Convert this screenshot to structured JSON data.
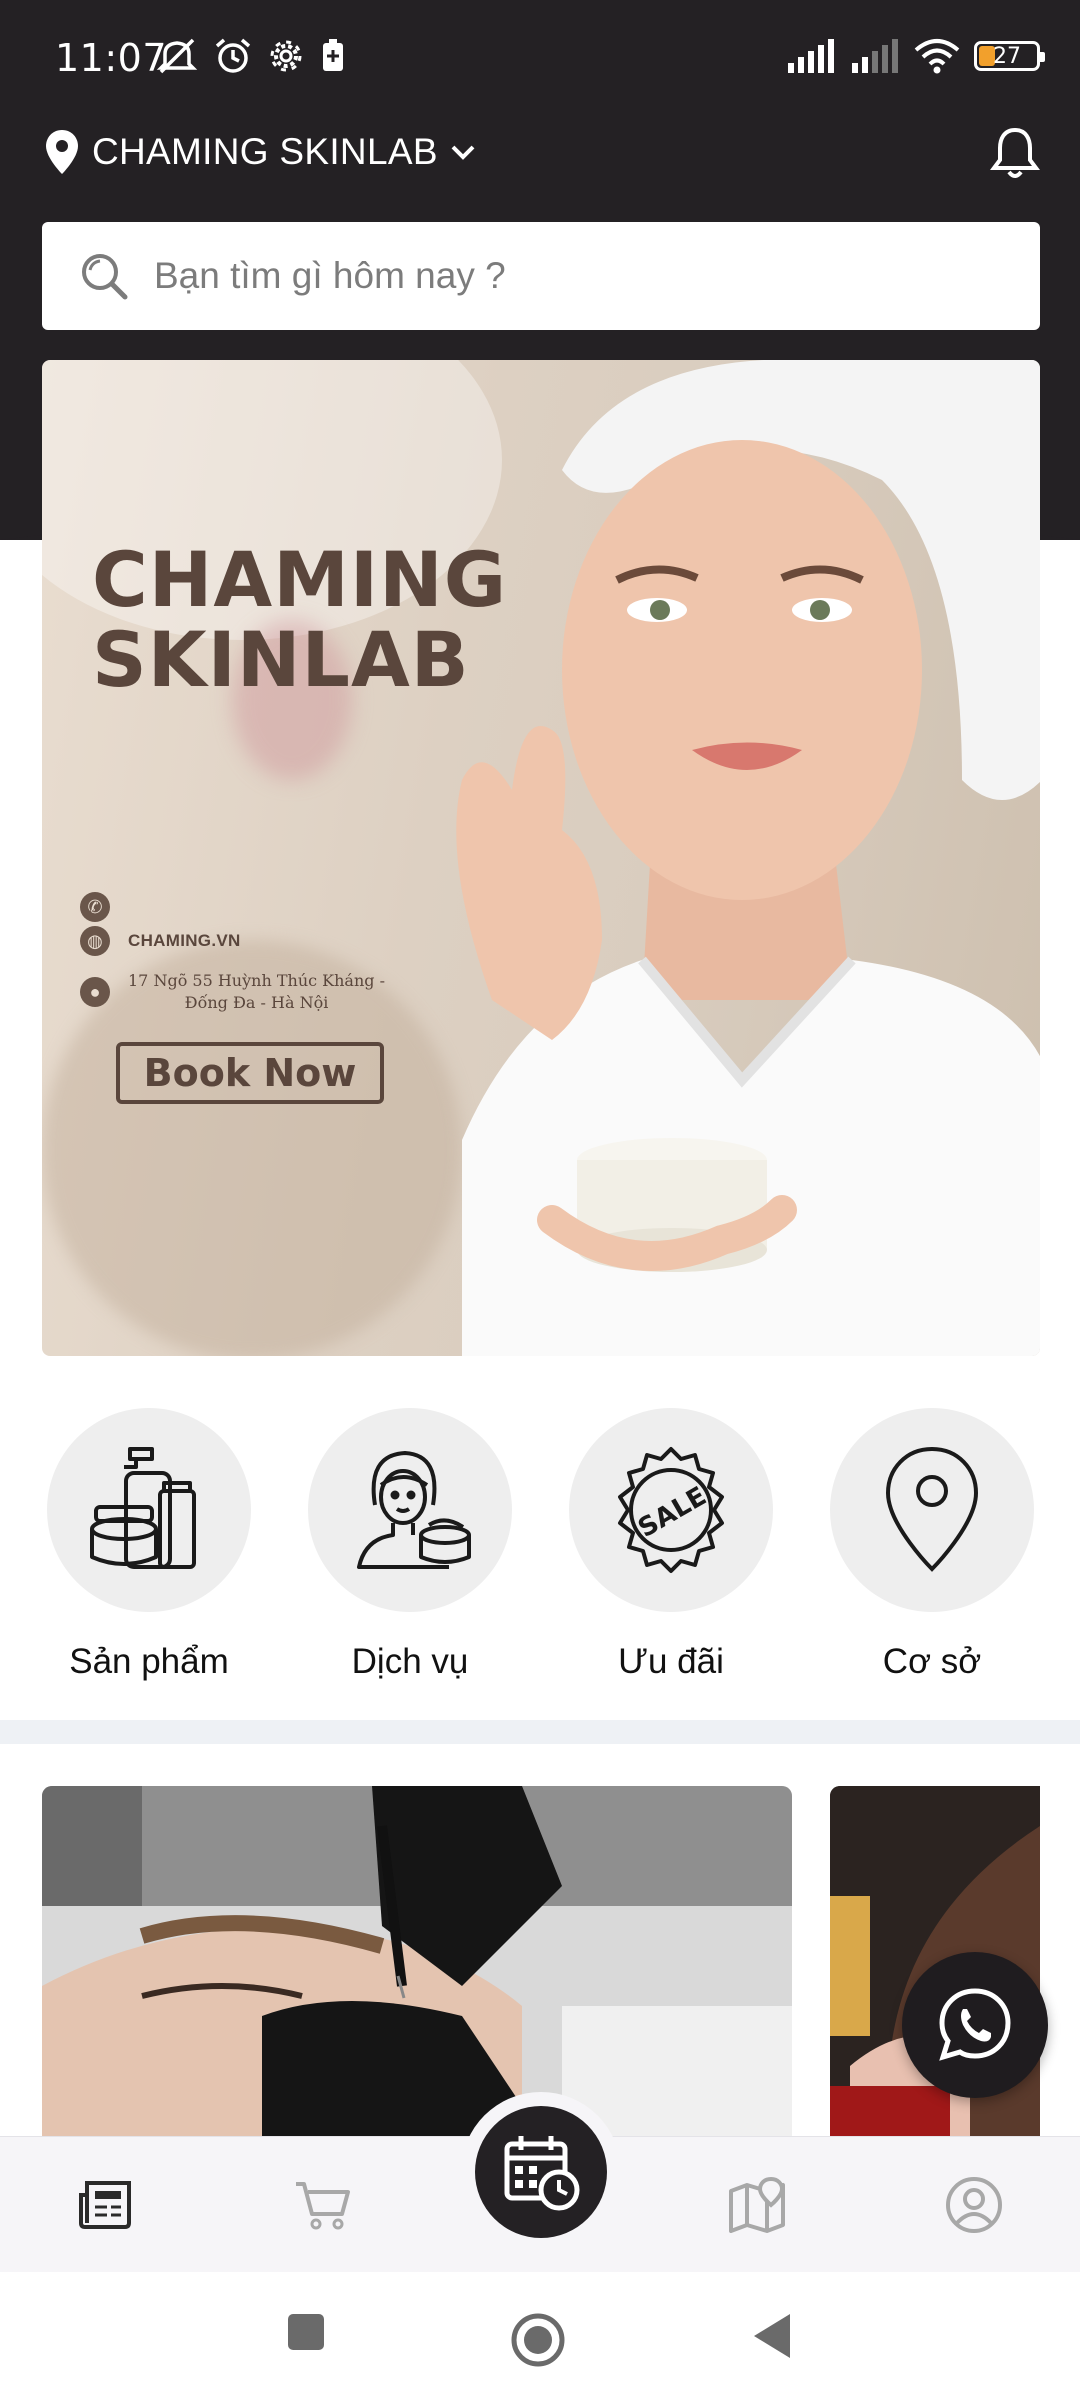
{
  "status_bar": {
    "time": "11:07",
    "battery": "27",
    "icons_left": [
      "mute-icon",
      "alarm-icon",
      "settings-gear-icon",
      "battery-saver-icon"
    ],
    "icons_right": [
      "signal-icon",
      "signal-icon",
      "wifi-icon",
      "battery-icon"
    ]
  },
  "header": {
    "location": "CHAMING SKINLAB",
    "icons": [
      "location-pin-icon",
      "chevron-down-icon",
      "bell-icon"
    ]
  },
  "search": {
    "placeholder": "Bạn tìm gì hôm nay ?"
  },
  "banner": {
    "title_line1": "CHAMING",
    "title_line2": "SKINLAB",
    "cta": "Book Now",
    "website": "CHAMING.VN",
    "address_line1": "17 Ngõ 55 Huỳnh Thúc Kháng -",
    "address_line2": "Đống Đa - Hà Nội"
  },
  "categories": [
    {
      "label": "Sản phẩm",
      "icon": "cosmetics-bottles-icon"
    },
    {
      "label": "Dịch vụ",
      "icon": "beauty-service-icon"
    },
    {
      "label": "Ưu đãi",
      "icon": "sale-badge-icon"
    },
    {
      "label": "Cơ sở",
      "icon": "location-pin-icon"
    }
  ],
  "bottom_nav": {
    "items": [
      "news-icon",
      "cart-icon",
      "calendar-booking-icon",
      "map-icon",
      "account-icon"
    ]
  },
  "colors": {
    "header_bg": "#242124",
    "banner_text": "#5a463c",
    "category_circle": "#eeeeee",
    "nav_bg": "#f6f5f8"
  }
}
